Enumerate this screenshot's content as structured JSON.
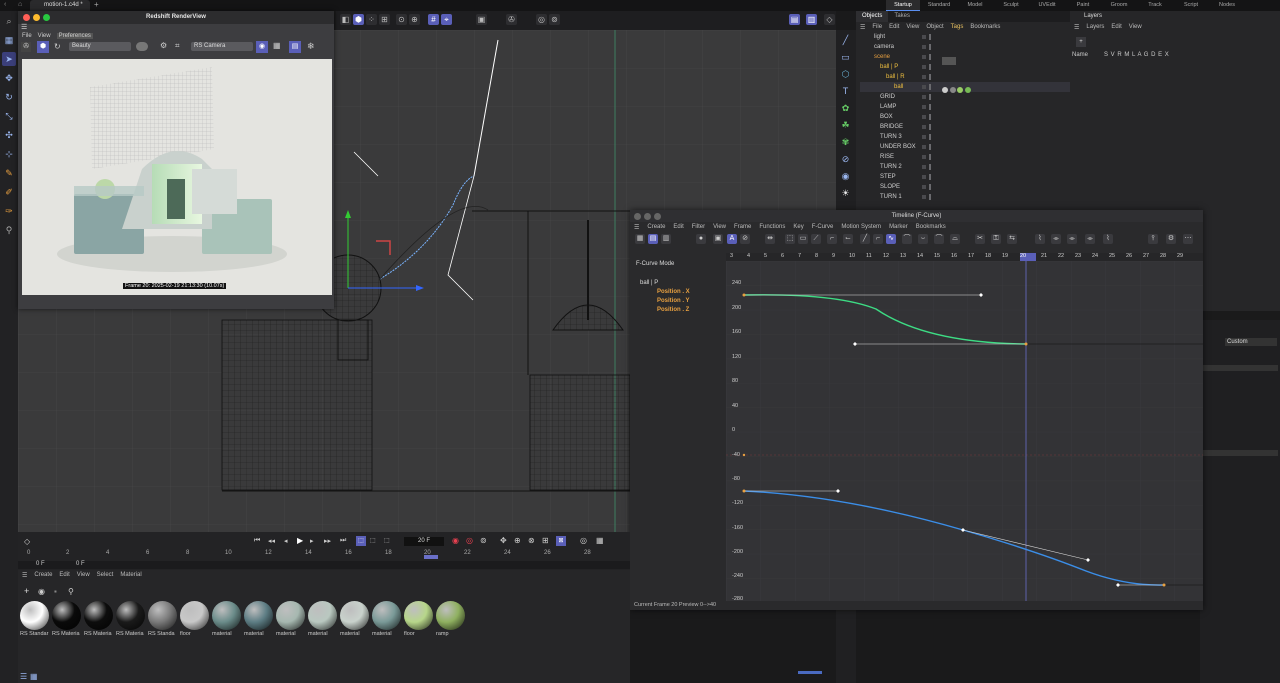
{
  "top": {
    "doc_tab": "motion-1.c4d *",
    "layouts": [
      "Startup",
      "Standard",
      "Model",
      "Sculpt",
      "UVEdit",
      "Paint",
      "Groom",
      "Track",
      "Script",
      "Nodes"
    ]
  },
  "renderview": {
    "title": "Redshift RenderView",
    "menu": [
      "File",
      "View",
      "Preferences"
    ],
    "aov": "Beauty",
    "camera": "RS Camera",
    "status": "Frame  20:  2025-02-19  21:13:30  (10.07s)"
  },
  "objects": {
    "tabs": [
      "Objects",
      "Takes"
    ],
    "menu": [
      "File",
      "Edit",
      "View",
      "Object",
      "Tags",
      "Bookmarks"
    ],
    "rows": [
      "light",
      "camera",
      "scene",
      "ball | P",
      "ball | R",
      "ball",
      "GRID",
      "LAMP",
      "BOX",
      "BRIDGE",
      "TURN 3",
      "UNDER BOX",
      "RISE",
      "TURN 2",
      "STEP",
      "SLOPE",
      "TURN 1"
    ]
  },
  "layers": {
    "title": "Layers",
    "menu": [
      "Layers",
      "Edit",
      "View"
    ],
    "header_name": "Name",
    "header_cols": "S V R M L A G D E X"
  },
  "attr": {
    "dropdown": "Custom"
  },
  "timeline": {
    "title": "Timeline (F-Curve)",
    "menu": [
      "Create",
      "Edit",
      "Filter",
      "View",
      "Frame",
      "Functions",
      "Key",
      "F-Curve",
      "Motion System",
      "Marker",
      "Bookmarks"
    ],
    "mode": "F-Curve Mode",
    "tracks": [
      "ball | P",
      "Position . X",
      "Position . Y",
      "Position . Z"
    ],
    "frames": [
      "3",
      "4",
      "5",
      "6",
      "7",
      "8",
      "9",
      "10",
      "11",
      "12",
      "13",
      "14",
      "15",
      "16",
      "17",
      "18",
      "19",
      "20",
      "21",
      "22",
      "23",
      "24",
      "25",
      "26",
      "27",
      "28",
      "29"
    ],
    "yvalues": [
      "240",
      "200",
      "160",
      "120",
      "80",
      "40",
      "0",
      "-40",
      "-80",
      "-120",
      "-160",
      "-200",
      "-240",
      "-280"
    ],
    "footer": "Current Frame  20  Preview  0-->40"
  },
  "playbar": {
    "frame_field": "20 F",
    "ruler": [
      "0",
      "2",
      "4",
      "6",
      "8",
      "10",
      "12",
      "14",
      "16",
      "18",
      "20",
      "22",
      "24",
      "26",
      "28"
    ],
    "start": "0 F",
    "end": "0 F"
  },
  "materials": {
    "menu": [
      "Create",
      "Edit",
      "View",
      "Select",
      "Material"
    ],
    "items": [
      {
        "label": "RS Standar",
        "color": "#ffffff"
      },
      {
        "label": "RS Materia",
        "color": "#0a0a0a"
      },
      {
        "label": "RS Materia",
        "color": "#0d0d0d"
      },
      {
        "label": "RS Materia",
        "color": "#1a1a1a"
      },
      {
        "label": "RS Standa",
        "color": "#7a7a7a"
      },
      {
        "label": "floor",
        "color": "#c8c8c8"
      },
      {
        "label": "material",
        "color": "#6b8c8a"
      },
      {
        "label": "material",
        "color": "#5d7d84"
      },
      {
        "label": "material",
        "color": "#a6b8b0"
      },
      {
        "label": "material",
        "color": "#b9c8c0"
      },
      {
        "label": "material",
        "color": "#c9d2cc"
      },
      {
        "label": "material",
        "color": "#7a9a98"
      },
      {
        "label": "floor",
        "color": "#b7d68a"
      },
      {
        "label": "ramp",
        "color": "#8fb060"
      }
    ]
  }
}
